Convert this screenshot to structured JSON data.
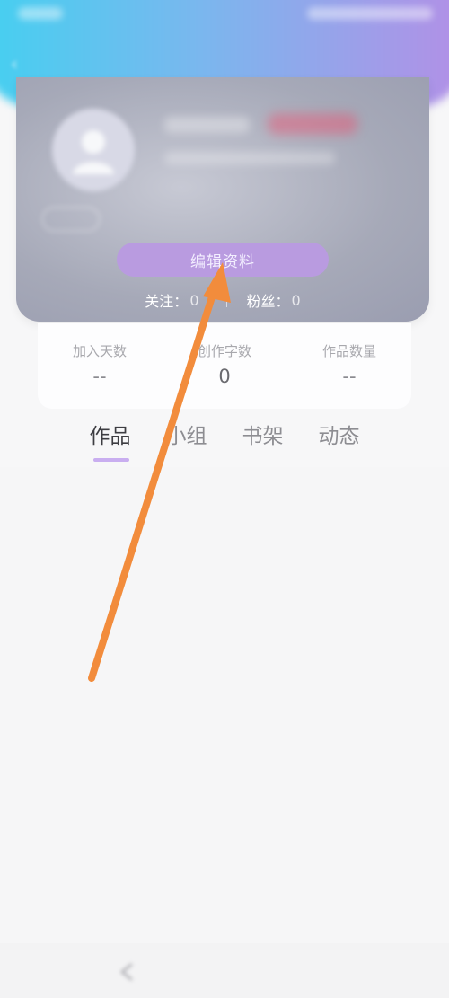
{
  "profile": {
    "edit_label": "编辑资料",
    "follow_label": "关注：",
    "follow_count": "0",
    "fans_label": "粉丝：",
    "fans_count": "0"
  },
  "stats": [
    {
      "label": "加入天数",
      "value": "--"
    },
    {
      "label": "创作字数",
      "value": "0"
    },
    {
      "label": "作品数量",
      "value": "--"
    }
  ],
  "tabs": [
    {
      "label": "作品",
      "active": true
    },
    {
      "label": "小组",
      "active": false
    },
    {
      "label": "书架",
      "active": false
    },
    {
      "label": "动态",
      "active": false
    }
  ],
  "colors": {
    "header_gradient_start": "#44d0f0",
    "header_gradient_end": "#b38fe6",
    "edit_button": "#b99be0",
    "tab_indicator": "#c9aef0",
    "annotation_arrow": "#f28c3c"
  },
  "icons": {
    "back": "back-arrow-icon",
    "avatar": "user-avatar-icon",
    "nav_back": "nav-back-icon",
    "annotation": "arrow-icon"
  }
}
